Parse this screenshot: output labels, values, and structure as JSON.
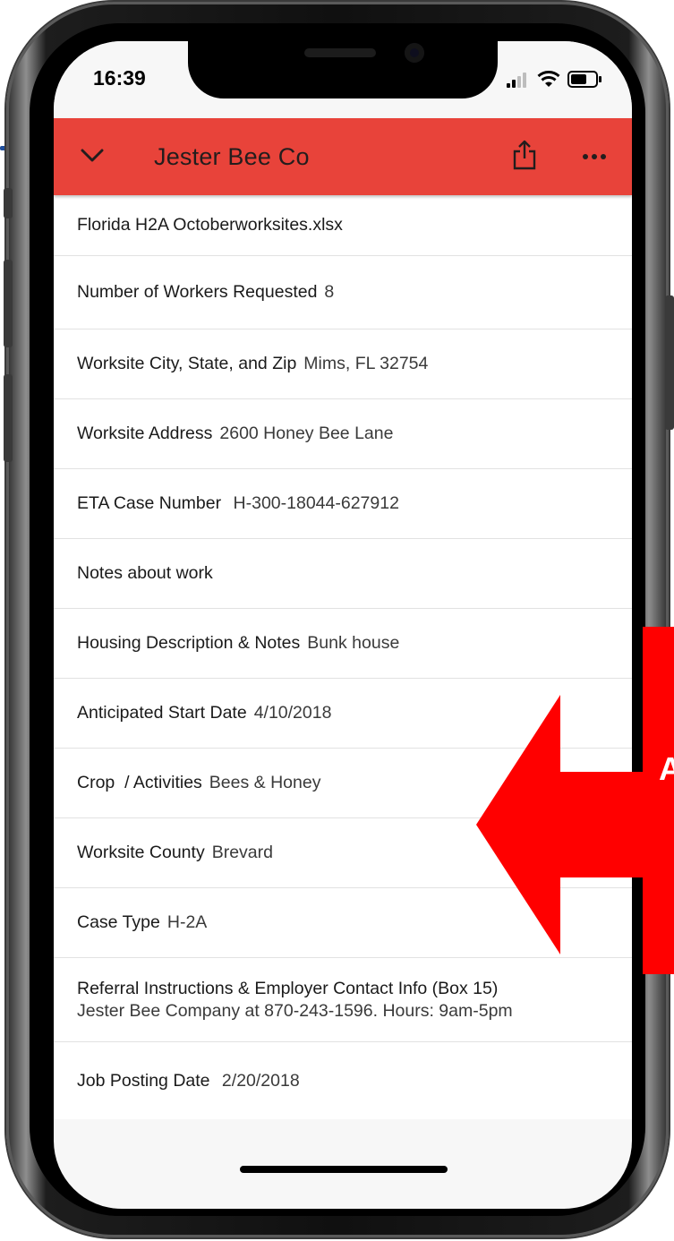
{
  "status_bar": {
    "time": "16:39"
  },
  "header": {
    "title": "Jester Bee Co",
    "chevron_icon": "chevron-down-icon",
    "share_icon": "share-icon",
    "more_icon": "more-horizontal-icon",
    "color": "#e8433a"
  },
  "file_name": "Florida H2A Octoberworksites.xlsx",
  "fields": [
    {
      "label": "Number of Workers Requested",
      "value": "8"
    },
    {
      "label": "Worksite City, State, and Zip",
      "value": "Mims, FL 32754"
    },
    {
      "label": "Worksite Address",
      "value": "2600 Honey Bee Lane"
    },
    {
      "label": "ETA Case Number",
      "value": " H-300-18044-627912"
    },
    {
      "label": "Notes about work",
      "value": ""
    },
    {
      "label": "Housing Description & Notes",
      "value": "Bunk house"
    },
    {
      "label": "Anticipated Start Date",
      "value": "4/10/2018"
    },
    {
      "label": "Crop  / Activities",
      "value": "Bees & Honey"
    },
    {
      "label": "Worksite County",
      "value": "Brevard"
    },
    {
      "label": "Case Type",
      "value": "H-2A"
    },
    {
      "label": "Referral Instructions & Employer Contact Info (Box 15)",
      "value": "Jester Bee Company at 870-243-1596. Hours: 9am-5pm"
    },
    {
      "label": "Job Posting Date",
      "value": " 2/20/2018"
    }
  ],
  "overlay": {
    "callout_letter": "A",
    "color": "#ff0000"
  }
}
